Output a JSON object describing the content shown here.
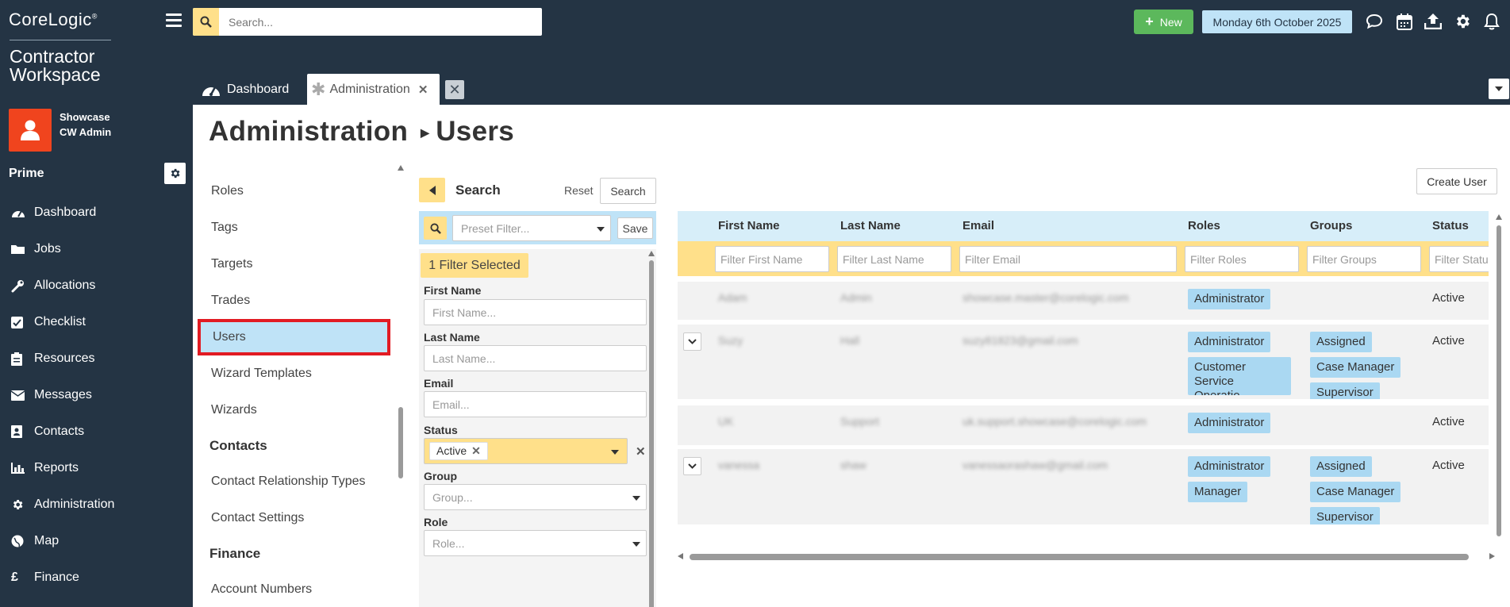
{
  "brand": {
    "logo": "CoreLogic",
    "product": "Contractor Workspace"
  },
  "user": {
    "org": "Showcase",
    "name": "CW Admin"
  },
  "sidebar": {
    "section": "Prime",
    "items": [
      {
        "label": "Dashboard",
        "icon": "dashboard-icon"
      },
      {
        "label": "Jobs",
        "icon": "folder-icon"
      },
      {
        "label": "Allocations",
        "icon": "wrench-icon"
      },
      {
        "label": "Checklist",
        "icon": "checklist-icon"
      },
      {
        "label": "Resources",
        "icon": "clipboard-icon"
      },
      {
        "label": "Messages",
        "icon": "envelope-icon"
      },
      {
        "label": "Contacts",
        "icon": "contact-card-icon"
      },
      {
        "label": "Reports",
        "icon": "bar-chart-icon"
      },
      {
        "label": "Administration",
        "icon": "gear-icon"
      },
      {
        "label": "Map",
        "icon": "globe-icon"
      },
      {
        "label": "Finance",
        "icon": "pound-icon"
      }
    ]
  },
  "topbar": {
    "search_placeholder": "Search...",
    "new_label": "New",
    "date": "Monday 6th October 2025"
  },
  "tabs": {
    "dashboard": "Dashboard",
    "administration": "Administration"
  },
  "page": {
    "section": "Administration",
    "title": "Users"
  },
  "settings_list": {
    "items_top": [
      "Roles",
      "Tags",
      "Targets",
      "Trades",
      "Users",
      "Wizard Templates",
      "Wizards"
    ],
    "contacts_head": "Contacts",
    "contacts_items": [
      "Contact Relationship Types",
      "Contact Settings"
    ],
    "finance_head": "Finance",
    "finance_items": [
      "Account Numbers"
    ]
  },
  "filter": {
    "title": "Search",
    "reset": "Reset",
    "search": "Search",
    "preset_placeholder": "Preset Filter...",
    "save": "Save",
    "selected": "1 Filter Selected",
    "first_name_label": "First Name",
    "first_name_placeholder": "First Name...",
    "last_name_label": "Last Name",
    "last_name_placeholder": "Last Name...",
    "email_label": "Email",
    "email_placeholder": "Email...",
    "status_label": "Status",
    "status_value": "Active",
    "group_label": "Group",
    "group_placeholder": "Group...",
    "role_label": "Role",
    "role_placeholder": "Role..."
  },
  "create_user": "Create User",
  "grid": {
    "columns": [
      "First Name",
      "Last Name",
      "Email",
      "Roles",
      "Groups",
      "Status"
    ],
    "filters": [
      "Filter First Name",
      "Filter Last Name",
      "Filter Email",
      "Filter Roles",
      "Filter Groups",
      "Filter Statu"
    ],
    "rows": [
      {
        "first": "Adam",
        "last": "Admin",
        "email": "showcase.master@corelogic.com",
        "roles": [
          "Administrator"
        ],
        "groups": [],
        "status": "Active"
      },
      {
        "first": "Suzy",
        "last": "Hall",
        "email": "suzy81823@gmail.com",
        "roles": [
          "Administrator",
          "Customer Service",
          "Operatio..."
        ],
        "groups": [
          "Assigned",
          "Case Manager",
          "Supervisor"
        ],
        "status": "Active"
      },
      {
        "first": "UK",
        "last": "Support",
        "email": "uk.support.showcase@corelogic.com",
        "roles": [
          "Administrator"
        ],
        "groups": [],
        "status": "Active"
      },
      {
        "first": "vanessa",
        "last": "shaw",
        "email": "vanessaorashaw@gmail.com",
        "roles": [
          "Administrator",
          "Manager"
        ],
        "groups": [
          "Assigned",
          "Case Manager",
          "Supervisor"
        ],
        "status": "Active"
      }
    ]
  }
}
